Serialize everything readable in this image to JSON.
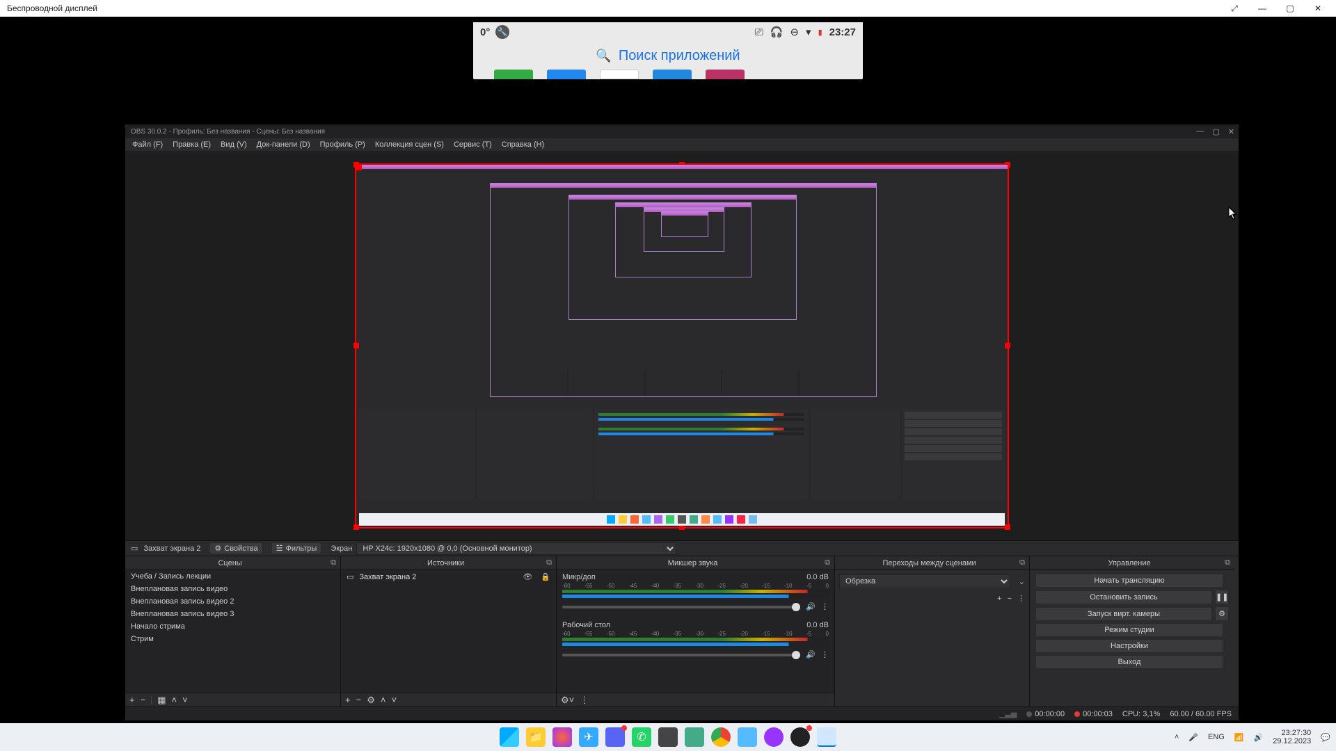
{
  "wireless_display_title": "Беспроводной дисплей",
  "phone": {
    "temp": "0°",
    "time": "23:27",
    "search": "Поиск приложений"
  },
  "obs": {
    "title": "OBS 30.0.2 - Профиль: Без названия - Сцены: Без названия",
    "menu": [
      "Файл (F)",
      "Правка (E)",
      "Вид (V)",
      "Док-панели (D)",
      "Профиль (P)",
      "Коллекция сцен (S)",
      "Сервис (T)",
      "Справка (H)"
    ],
    "source_toolbar": {
      "source_name": "Захват экрана 2",
      "properties": "Свойства",
      "filters": "Фильтры",
      "screen_label": "Экран",
      "screen_value": "HP X24c: 1920x1080 @ 0,0 (Основной монитор)"
    },
    "docks": {
      "scenes": {
        "title": "Сцены",
        "items": [
          "Учеба / Запись лекции",
          "Внеплановая запись видео",
          "Внеплановая запись видео 2",
          "Внеплановая запись видео 3",
          "Начало стрима",
          "Стрим"
        ]
      },
      "sources": {
        "title": "Источники",
        "items": [
          "Захват экрана 2"
        ]
      },
      "mixer": {
        "title": "Микшер звука",
        "channels": [
          {
            "name": "Микр/доп",
            "level": "0.0 dB"
          },
          {
            "name": "Рабочий стол",
            "level": "0.0 dB"
          }
        ],
        "scale": [
          "-60",
          "-55",
          "-50",
          "-45",
          "-40",
          "-35",
          "-30",
          "-25",
          "-20",
          "-15",
          "-10",
          "-5",
          "0"
        ]
      },
      "transitions": {
        "title": "Переходы между сценами",
        "selected": "Обрезка"
      },
      "controls": {
        "title": "Управление",
        "start_stream": "Начать трансляцию",
        "stop_rec": "Остановить запись",
        "start_vcam": "Запуск вирт. камеры",
        "studio_mode": "Режим студии",
        "settings": "Настройки",
        "exit": "Выход"
      }
    },
    "status": {
      "live": "00:00:00",
      "rec": "00:00:03",
      "cpu": "CPU: 3,1%",
      "fps": "60.00 / 60.00 FPS"
    }
  },
  "taskbar": {
    "lang": "ENG",
    "time": "23:27:30",
    "date": "29.12.2023"
  }
}
